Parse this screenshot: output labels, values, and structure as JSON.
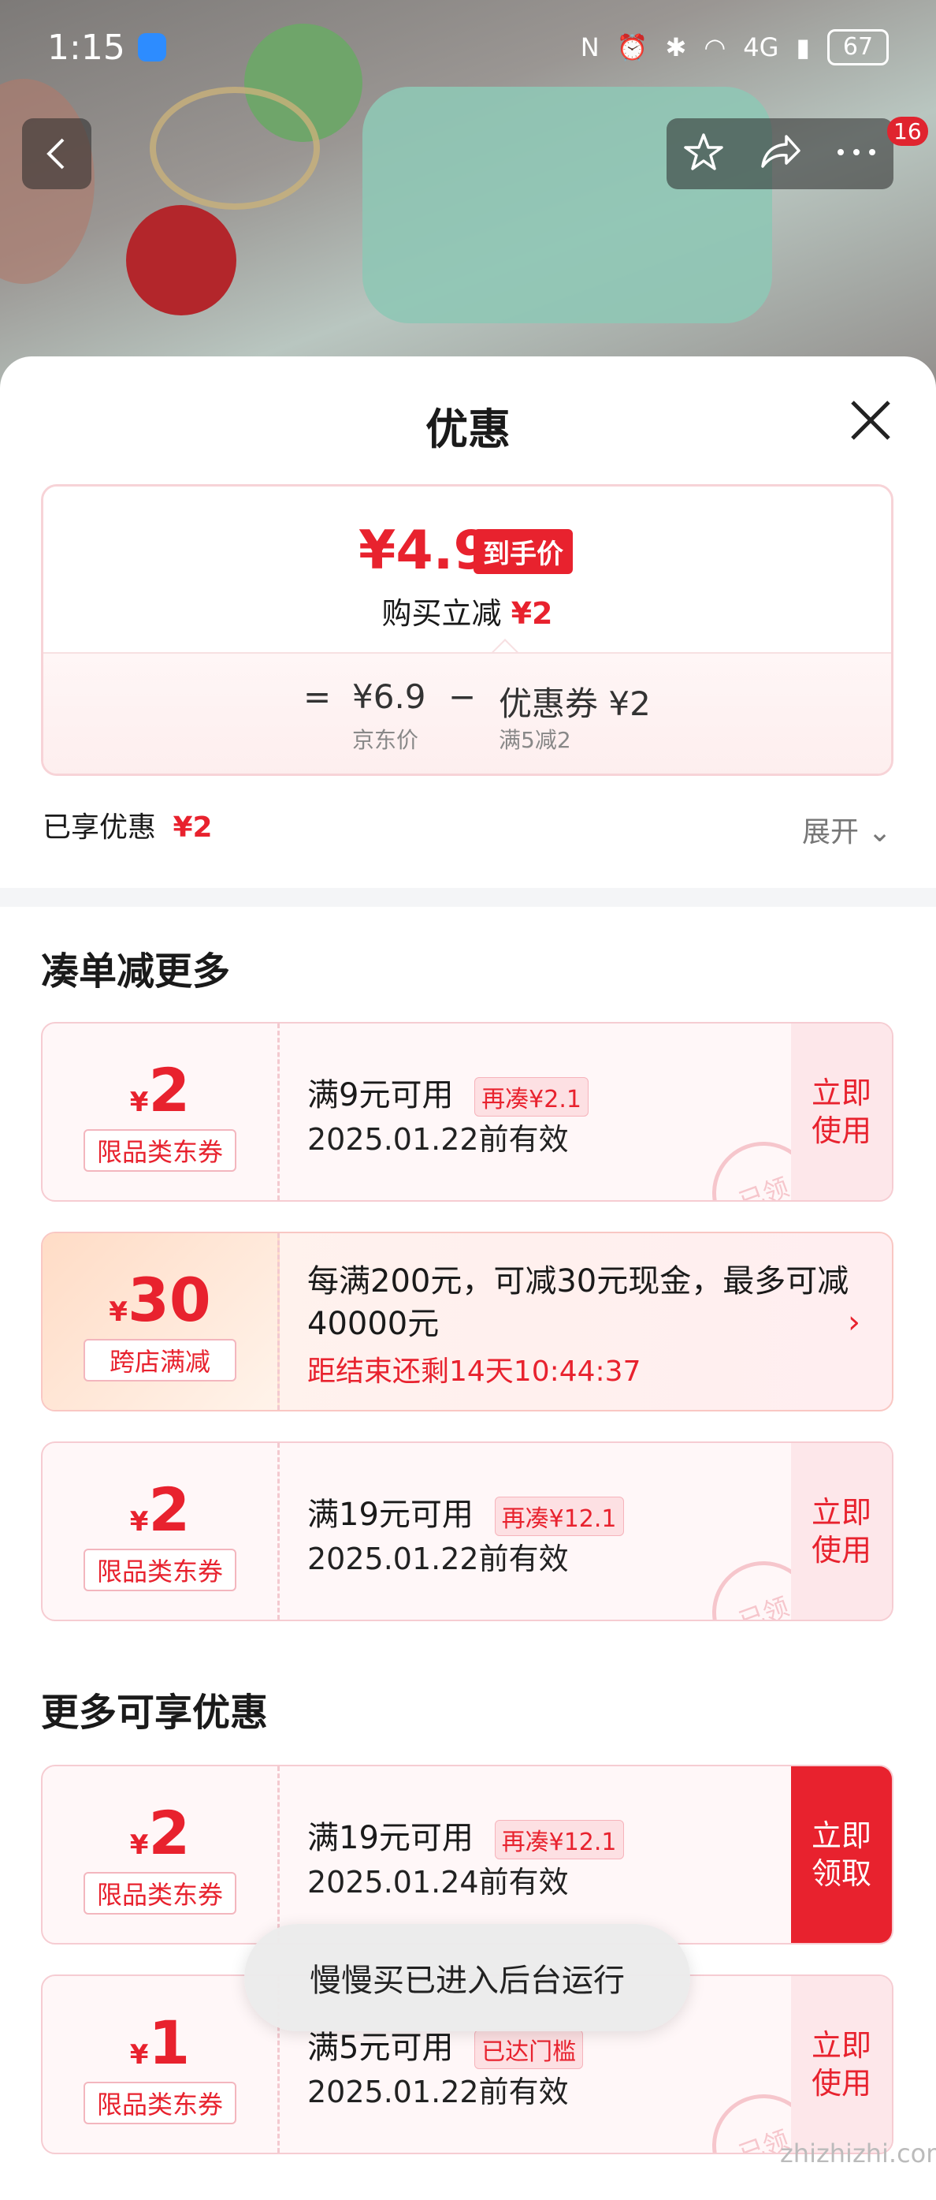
{
  "status_bar": {
    "time": "1:15",
    "battery": "67",
    "network": "4G"
  },
  "header": {
    "notification_count": "16"
  },
  "sheet": {
    "title": "优惠"
  },
  "price_card": {
    "final_price": "¥4.9",
    "final_label": "到手价",
    "reduce_text": "购买立减",
    "reduce_amount": "¥2",
    "equals": "=",
    "jd_price": "¥6.9",
    "jd_price_label": "京东价",
    "minus": "−",
    "coupon_text": "优惠券 ¥2",
    "coupon_rule": "满5减2"
  },
  "enjoyed": {
    "label": "已享优惠",
    "amount": "¥2",
    "expand_label": "展开"
  },
  "section_more_order": {
    "title": "凑单减更多"
  },
  "section_more_benefits": {
    "title": "更多可享优惠"
  },
  "coupons": [
    {
      "yen": "¥",
      "amount": "2",
      "tag": "限品类东券",
      "condition": "满9元可用",
      "pill": "再凑¥2.1",
      "valid": "2025.01.22前有效",
      "action": "立即使用",
      "stamp": "已领"
    },
    {
      "yen": "¥",
      "amount": "30",
      "tag": "跨店满减",
      "desc": "每满200元，可减30元现金，最多可减40000元",
      "countdown": "距结束还剩14天10:44:37"
    },
    {
      "yen": "¥",
      "amount": "2",
      "tag": "限品类东券",
      "condition": "满19元可用",
      "pill": "再凑¥12.1",
      "valid": "2025.01.22前有效",
      "action": "立即使用",
      "stamp": "已领"
    },
    {
      "yen": "¥",
      "amount": "2",
      "tag": "限品类东券",
      "condition": "满19元可用",
      "pill": "再凑¥12.1",
      "valid": "2025.01.24前有效",
      "action": "立即领取"
    },
    {
      "yen": "¥",
      "amount": "1",
      "tag": "限品类东券",
      "condition": "满5元可用",
      "pill": "已达门槛",
      "valid": "2025.01.22前有效",
      "action": "立即使用",
      "stamp": "已领"
    }
  ],
  "toast": {
    "text": "慢慢买已进入后台运行"
  },
  "watermark": "zhizhizhi.com",
  "colors": {
    "accent_red": "#e8222e",
    "coupon_bg": "#fff7f8",
    "sheet_bg": "#ffffff"
  }
}
